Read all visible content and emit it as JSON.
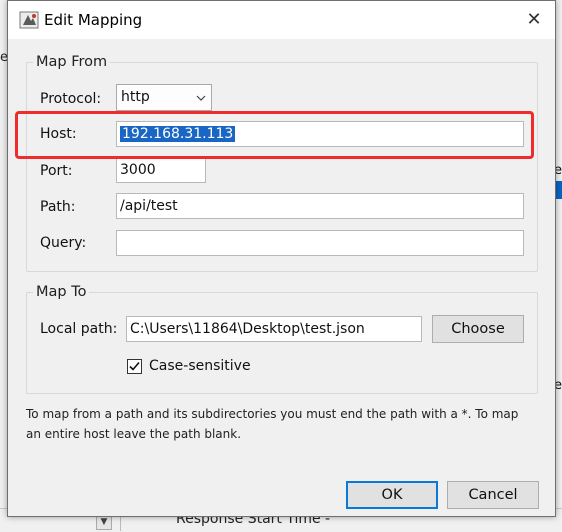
{
  "dialog": {
    "title": "Edit Mapping",
    "icons": {
      "app": "app-icon",
      "close": "close-icon"
    }
  },
  "map_from": {
    "legend": "Map From",
    "protocol_label": "Protocol:",
    "protocol_value": "http",
    "host_label": "Host:",
    "host_value": "192.168.31.113",
    "port_label": "Port:",
    "port_value": "3000",
    "path_label": "Path:",
    "path_value": "/api/test",
    "query_label": "Query:",
    "query_value": ""
  },
  "map_to": {
    "legend": "Map To",
    "local_path_label": "Local path:",
    "local_path_value": "C:\\Users\\11864\\Desktop\\test.json",
    "choose_label": "Choose",
    "case_sensitive_label": "Case-sensitive",
    "case_sensitive_checked": true
  },
  "hint": "To map from a path and its subdirectories you must end the path with a *. To map an entire host leave the path blank.",
  "buttons": {
    "ok": "OK",
    "cancel": "Cancel"
  },
  "background": {
    "left_fragment": "e",
    "right_fragment": "te",
    "right_fragment_2": "e",
    "bottom_text": "Response Start Time   -"
  },
  "colors": {
    "highlight": "#ef2b2b",
    "selection": "#1a66c4",
    "default_button_border": "#0a78d7"
  }
}
